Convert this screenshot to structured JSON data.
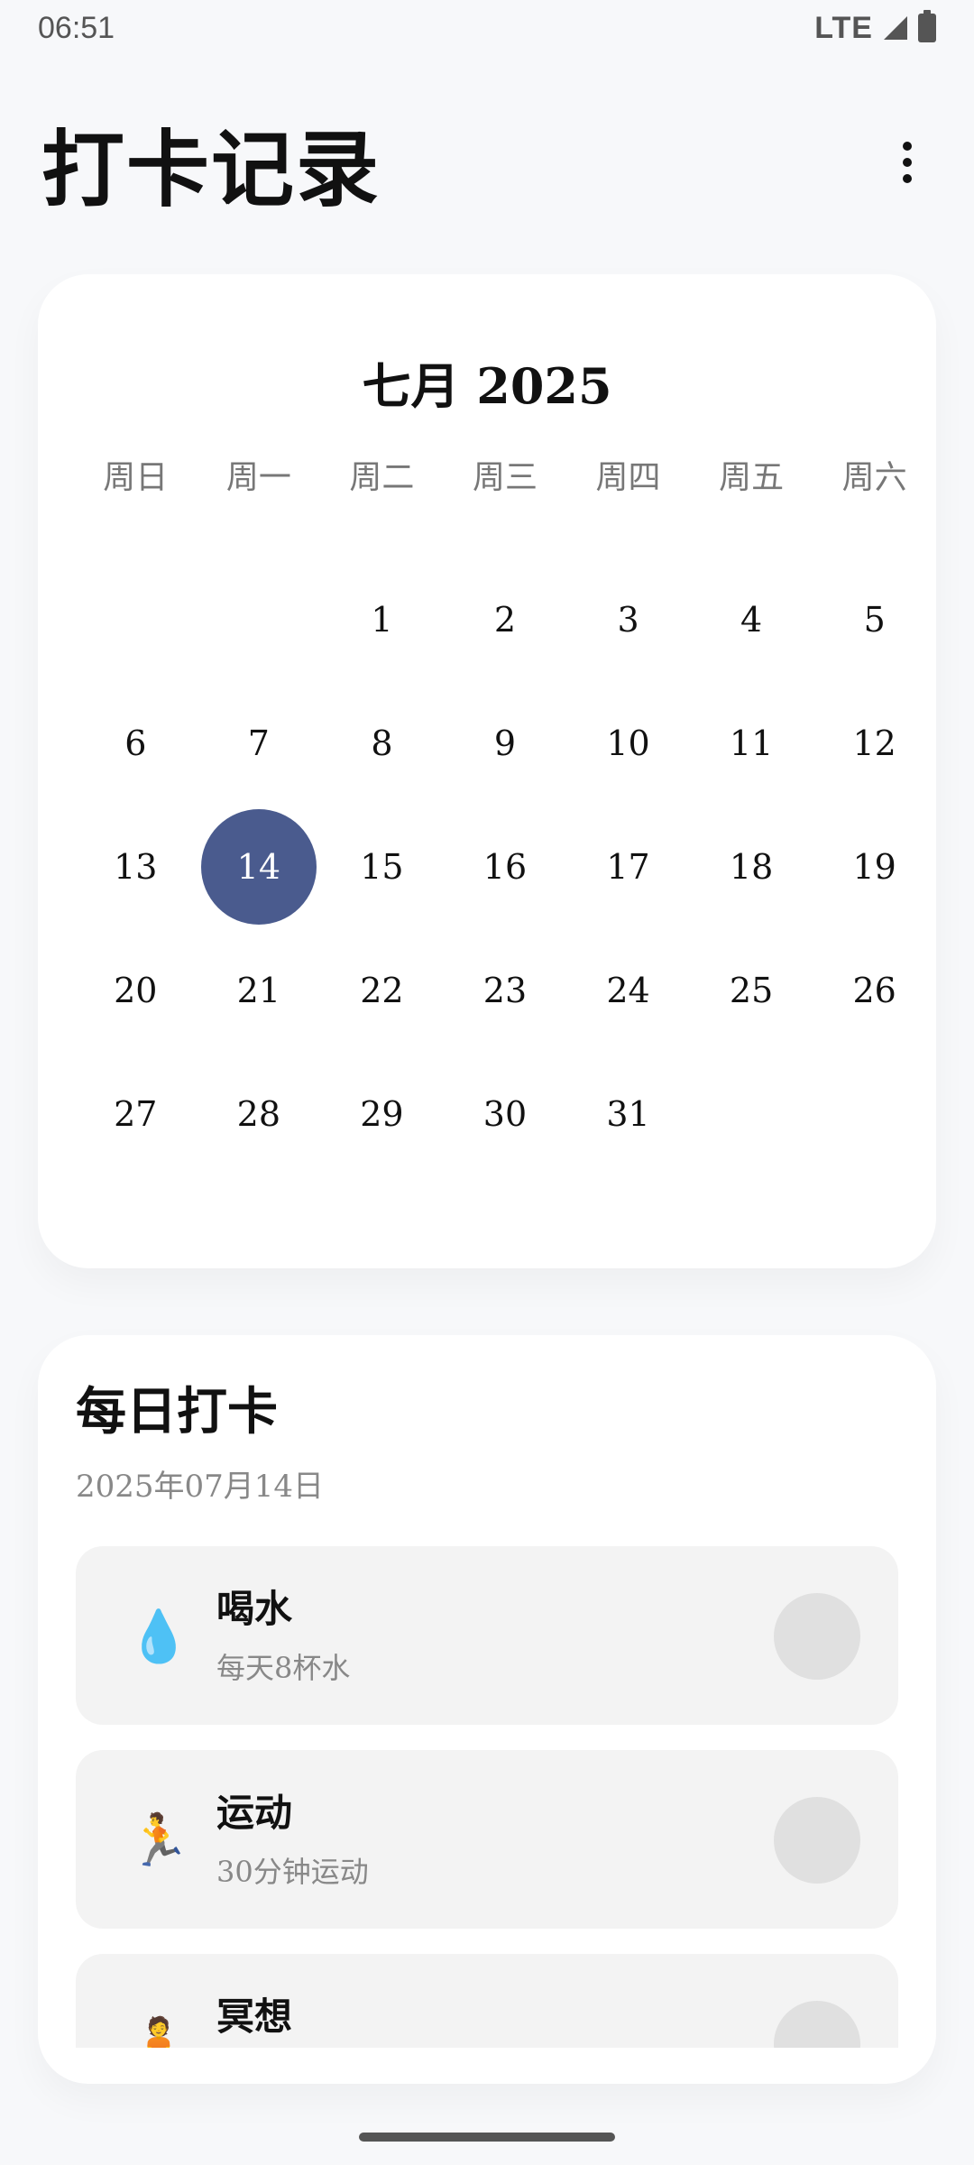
{
  "status_bar": {
    "time": "06:51",
    "network": "LTE",
    "icons": [
      "signal-icon",
      "battery-icon"
    ]
  },
  "header": {
    "title": "打卡记录",
    "menu_icon": "more-vert-icon"
  },
  "calendar": {
    "month_label": "七月 2025",
    "weekdays": [
      "周日",
      "周一",
      "周二",
      "周三",
      "周四",
      "周五",
      "周六"
    ],
    "days": [
      "",
      "",
      "1",
      "2",
      "3",
      "4",
      "5",
      "6",
      "7",
      "8",
      "9",
      "10",
      "11",
      "12",
      "13",
      "14",
      "15",
      "16",
      "17",
      "18",
      "19",
      "20",
      "21",
      "22",
      "23",
      "24",
      "25",
      "26",
      "27",
      "28",
      "29",
      "30",
      "31",
      "",
      ""
    ],
    "selected_day": "14",
    "selected_color": "#4a5b8e"
  },
  "checkin": {
    "title": "每日打卡",
    "date": "2025年07月14日",
    "habits": [
      {
        "icon": "💧",
        "name": "喝水",
        "desc": "每天8杯水"
      },
      {
        "icon": "🏃",
        "name": "运动",
        "desc": "30分钟运动"
      },
      {
        "icon": "🧘",
        "name": "冥想",
        "desc": ""
      }
    ]
  }
}
